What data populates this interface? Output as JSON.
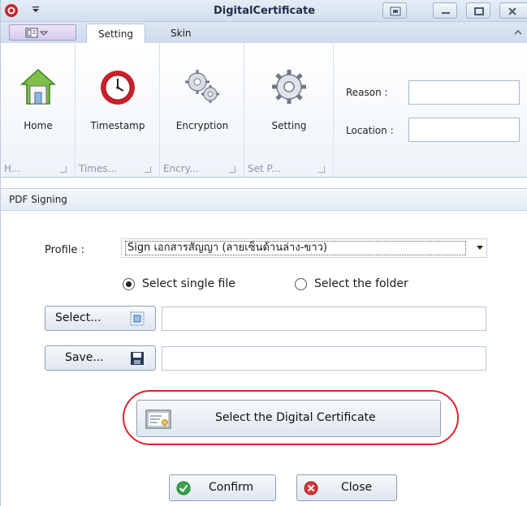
{
  "window": {
    "title": "DigitalCertificate"
  },
  "tabs": [
    {
      "label": "Setting",
      "active": true
    },
    {
      "label": "Skin",
      "active": false
    }
  ],
  "ribbon": {
    "buttons": {
      "home": "Home",
      "timestamp": "Timestamp",
      "encryption": "Encryption",
      "setting": "Setting"
    },
    "group_captions": {
      "home": "H...",
      "timestamp": "Times...",
      "encryption": "Encry...",
      "setting": "Set P..."
    },
    "reason_label": "Reason :",
    "reason_value": "",
    "location_label": "Location :",
    "location_value": ""
  },
  "panel": {
    "title": "PDF Signing",
    "profile_label": "Profile :",
    "profile_value": "Sign เอกสารสัญญา (ลายเซ็นด้านล่าง-ขาว)",
    "radio_single": "Select single file",
    "radio_folder": "Select the folder",
    "selected_mode": "single",
    "select_button": "Select...",
    "save_button": "Save...",
    "select_path": "",
    "save_path": "",
    "certificate_button": "Select the Digital Certificate",
    "confirm_button": "Confirm",
    "close_button": "Close"
  },
  "colors": {
    "accent": "#d7262d",
    "ribbon_bg": "#dde7f3",
    "confirm_green": "#3aa24a",
    "close_red": "#d8343b"
  }
}
